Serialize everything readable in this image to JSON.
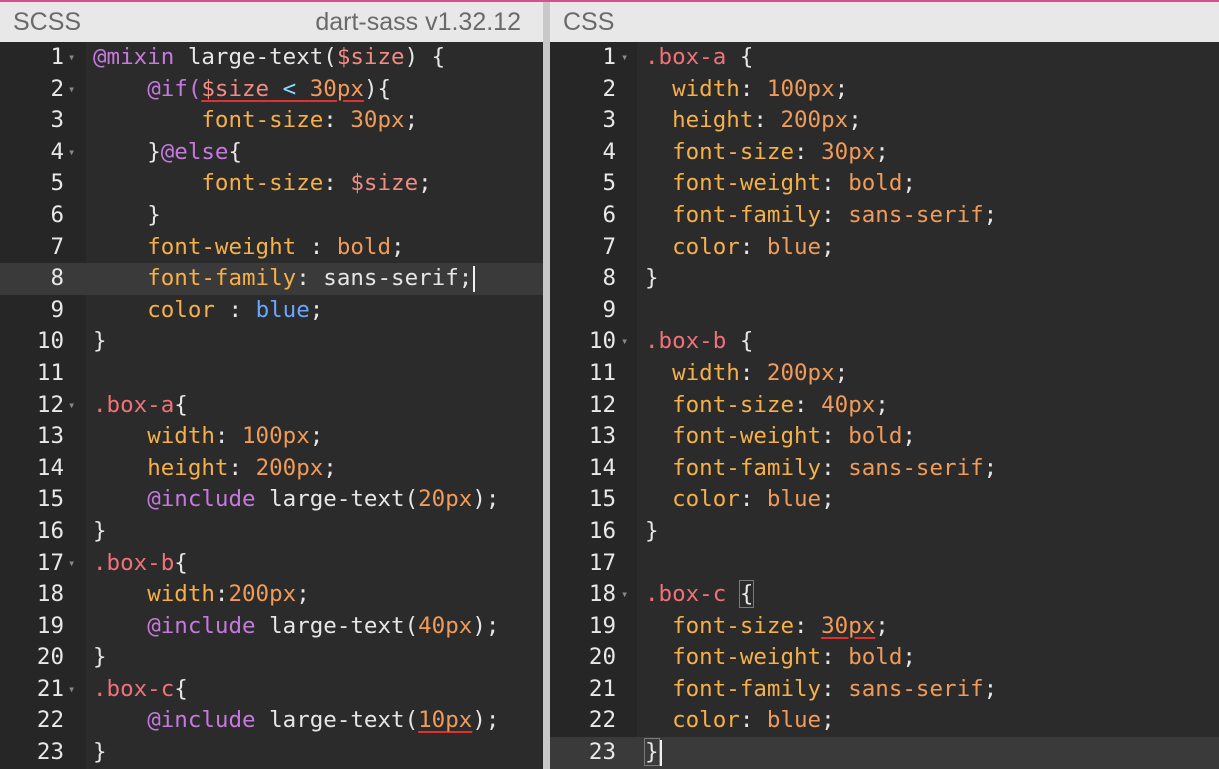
{
  "left": {
    "title": "SCSS",
    "engine": "dart-sass v1.32.12",
    "lines": [
      {
        "n": "1",
        "fold": true
      },
      {
        "n": "2",
        "fold": true
      },
      {
        "n": "3"
      },
      {
        "n": "4",
        "fold": true
      },
      {
        "n": "5"
      },
      {
        "n": "6"
      },
      {
        "n": "7"
      },
      {
        "n": "8",
        "active": true
      },
      {
        "n": "9"
      },
      {
        "n": "10"
      },
      {
        "n": "11"
      },
      {
        "n": "12",
        "fold": true
      },
      {
        "n": "13"
      },
      {
        "n": "14"
      },
      {
        "n": "15"
      },
      {
        "n": "16"
      },
      {
        "n": "17",
        "fold": true
      },
      {
        "n": "18"
      },
      {
        "n": "19"
      },
      {
        "n": "20"
      },
      {
        "n": "21",
        "fold": true
      },
      {
        "n": "22"
      },
      {
        "n": "23"
      }
    ],
    "tokens": {
      "l1_at": "@mixin",
      "l1_name": " large-text(",
      "l1_var": "$size",
      "l1_end": ") {",
      "l2_kw": "@if(",
      "l2_var": "$size",
      "l2_op": " < ",
      "l2_num": "30px",
      "l2_end": "){",
      "l3_prop": "font-size",
      "l3_colon": ": ",
      "l3_val": "30px",
      "l3_semi": ";",
      "l4_open": "}",
      "l4_kw": "@else",
      "l4_end": "{",
      "l5_prop": "font-size",
      "l5_colon": ": ",
      "l5_var": "$size",
      "l5_semi": ";",
      "l6": "}",
      "l7_prop": "font-weight",
      "l7_colon": " : ",
      "l7_val": "bold",
      "l7_semi": ";",
      "l8_prop": "font-family",
      "l8_colon": ": ",
      "l8_val": "sans-serif;",
      "l9_prop": "color",
      "l9_colon": " : ",
      "l9_val": "blue",
      "l9_semi": ";",
      "l10": "}",
      "l12_sel": ".box-a",
      "l12_end": "{",
      "l13_prop": "width",
      "l13_colon": ": ",
      "l13_val": "100px",
      "l13_semi": ";",
      "l14_prop": "height",
      "l14_colon": ": ",
      "l14_val": "200px",
      "l14_semi": ";",
      "l15_kw": "@include",
      "l15_fn": " large-text(",
      "l15_val": "20px",
      "l15_end": ");",
      "l16": "}",
      "l17_sel": ".box-b",
      "l17_end": "{",
      "l18_prop": "width",
      "l18_colon": ":",
      "l18_val": "200px",
      "l18_semi": ";",
      "l19_kw": "@include",
      "l19_fn": " large-text(",
      "l19_val": "40px",
      "l19_end": ");",
      "l20": "}",
      "l21_sel": ".box-c",
      "l21_end": "{",
      "l22_kw": "@include",
      "l22_fn": " large-text(",
      "l22_val": "10px",
      "l22_end": ");",
      "l23": "}"
    }
  },
  "right": {
    "title": "CSS",
    "lines": [
      {
        "n": "1",
        "fold": true
      },
      {
        "n": "2"
      },
      {
        "n": "3"
      },
      {
        "n": "4"
      },
      {
        "n": "5"
      },
      {
        "n": "6"
      },
      {
        "n": "7"
      },
      {
        "n": "8"
      },
      {
        "n": "9"
      },
      {
        "n": "10",
        "fold": true
      },
      {
        "n": "11"
      },
      {
        "n": "12"
      },
      {
        "n": "13"
      },
      {
        "n": "14"
      },
      {
        "n": "15"
      },
      {
        "n": "16"
      },
      {
        "n": "17"
      },
      {
        "n": "18",
        "fold": true
      },
      {
        "n": "19"
      },
      {
        "n": "20"
      },
      {
        "n": "21"
      },
      {
        "n": "22"
      },
      {
        "n": "23",
        "active": true
      }
    ],
    "tokens": {
      "r1_sel": ".box-a",
      "r1_end": " {",
      "r2_prop": "width",
      "r2_val": "100px",
      "r3_prop": "height",
      "r3_val": "200px",
      "r4_prop": "font-size",
      "r4_val": "30px",
      "r5_prop": "font-weight",
      "r5_val": "bold",
      "r6_prop": "font-family",
      "r6_val": "sans-serif",
      "r7_prop": "color",
      "r7_val": "blue",
      "r8": "}",
      "r10_sel": ".box-b",
      "r10_end": " {",
      "r11_prop": "width",
      "r11_val": "200px",
      "r12_prop": "font-size",
      "r12_val": "40px",
      "r13_prop": "font-weight",
      "r13_val": "bold",
      "r14_prop": "font-family",
      "r14_val": "sans-serif",
      "r15_prop": "color",
      "r15_val": "blue",
      "r16": "}",
      "r18_sel": ".box-c",
      "r18_end": "{",
      "r19_prop": "font-size",
      "r19_val": "30px",
      "r20_prop": "font-weight",
      "r20_val": "bold",
      "r21_prop": "font-family",
      "r21_val": "sans-serif",
      "r22_prop": "color",
      "r22_val": "blue",
      "r23": "}",
      "colon": ": ",
      "semi": ";",
      "indent": "  "
    }
  },
  "colors": {
    "accent": "#d84f8f",
    "annotation": "#e03030"
  }
}
